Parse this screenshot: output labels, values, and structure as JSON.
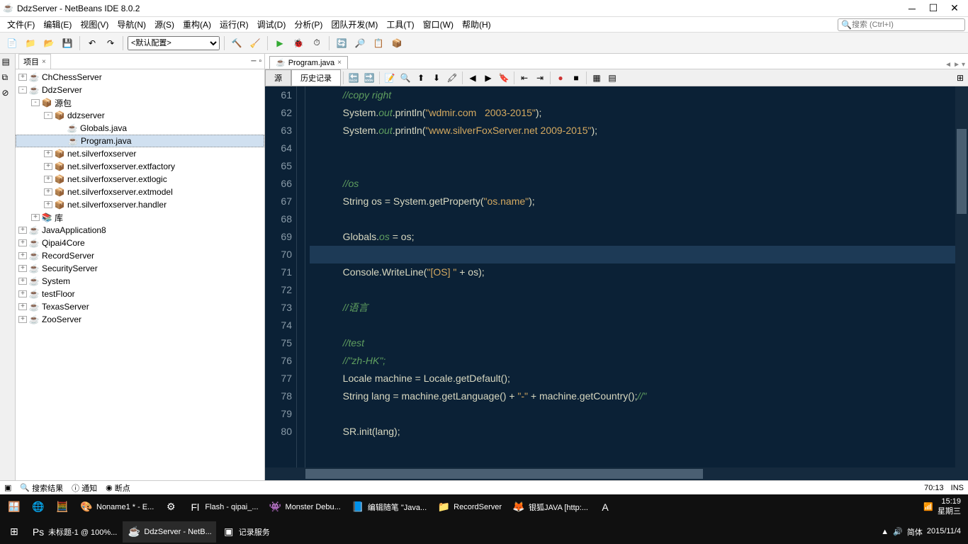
{
  "window": {
    "title": "DdzServer - NetBeans IDE 8.0.2"
  },
  "menu": {
    "items": [
      "文件(F)",
      "编辑(E)",
      "视图(V)",
      "导航(N)",
      "源(S)",
      "重构(A)",
      "运行(R)",
      "调试(D)",
      "分析(P)",
      "团队开发(M)",
      "工具(T)",
      "窗口(W)",
      "帮助(H)"
    ],
    "search_placeholder": "搜索 (Ctrl+I)"
  },
  "toolbar": {
    "config": "<默认配置>"
  },
  "sidebar": {
    "tab_title": "项目",
    "projects": [
      {
        "name": "ChChessServer",
        "level": 0,
        "exp": "+",
        "type": "cup"
      },
      {
        "name": "DdzServer",
        "level": 0,
        "exp": "-",
        "type": "cup"
      },
      {
        "name": "源包",
        "level": 1,
        "exp": "-",
        "type": "pkg"
      },
      {
        "name": "ddzserver",
        "level": 2,
        "exp": "-",
        "type": "pkg"
      },
      {
        "name": "Globals.java",
        "level": 3,
        "exp": "",
        "type": "java"
      },
      {
        "name": "Program.java",
        "level": 3,
        "exp": "",
        "type": "java",
        "selected": true
      },
      {
        "name": "net.silverfoxserver",
        "level": 2,
        "exp": "+",
        "type": "pkg"
      },
      {
        "name": "net.silverfoxserver.extfactory",
        "level": 2,
        "exp": "+",
        "type": "pkg"
      },
      {
        "name": "net.silverfoxserver.extlogic",
        "level": 2,
        "exp": "+",
        "type": "pkg"
      },
      {
        "name": "net.silverfoxserver.extmodel",
        "level": 2,
        "exp": "+",
        "type": "pkg"
      },
      {
        "name": "net.silverfoxserver.handler",
        "level": 2,
        "exp": "+",
        "type": "pkg"
      },
      {
        "name": "库",
        "level": 1,
        "exp": "+",
        "type": "lib"
      },
      {
        "name": "JavaApplication8",
        "level": 0,
        "exp": "+",
        "type": "cup"
      },
      {
        "name": "Qipai4Core",
        "level": 0,
        "exp": "+",
        "type": "cup"
      },
      {
        "name": "RecordServer",
        "level": 0,
        "exp": "+",
        "type": "cup"
      },
      {
        "name": "SecurityServer",
        "level": 0,
        "exp": "+",
        "type": "cup"
      },
      {
        "name": "System",
        "level": 0,
        "exp": "+",
        "type": "cup"
      },
      {
        "name": "testFloor",
        "level": 0,
        "exp": "+",
        "type": "cup"
      },
      {
        "name": "TexasServer",
        "level": 0,
        "exp": "+",
        "type": "cup"
      },
      {
        "name": "ZooServer",
        "level": 0,
        "exp": "+",
        "type": "cup"
      }
    ]
  },
  "editor": {
    "file_tab": "Program.java",
    "source_tab": "源",
    "history_tab": "历史记录",
    "lines": {
      "start": 61,
      "end": 80
    },
    "cursor": "70:13",
    "ins_mode": "INS"
  },
  "statusbar": {
    "search": "搜索结果",
    "notify": "通知",
    "breakpoint": "断点"
  },
  "taskbar": {
    "row1": [
      {
        "icon": "🪟",
        "label": ""
      },
      {
        "icon": "🌐",
        "label": ""
      },
      {
        "icon": "🧮",
        "label": ""
      },
      {
        "icon": "🎨",
        "label": "Noname1 * - E..."
      },
      {
        "icon": "⚙",
        "label": ""
      },
      {
        "icon": "Fl",
        "label": "Flash - qipai_..."
      },
      {
        "icon": "👾",
        "label": "Monster Debu..."
      },
      {
        "icon": "📘",
        "label": "编辑随笔 \"Java..."
      },
      {
        "icon": "📁",
        "label": "RecordServer"
      },
      {
        "icon": "🦊",
        "label": "银狐JAVA [http:..."
      },
      {
        "icon": "A",
        "label": ""
      }
    ],
    "row2": [
      {
        "icon": "⊞",
        "label": ""
      },
      {
        "icon": "Ps",
        "label": "未标题-1 @ 100%..."
      },
      {
        "icon": "☕",
        "label": "DdzServer - NetB...",
        "active": true
      },
      {
        "icon": "▣",
        "label": "记录服务"
      }
    ],
    "clock": {
      "time": "15:19",
      "day": "星期三",
      "date": "2015/11/4"
    },
    "ime": "简体"
  }
}
